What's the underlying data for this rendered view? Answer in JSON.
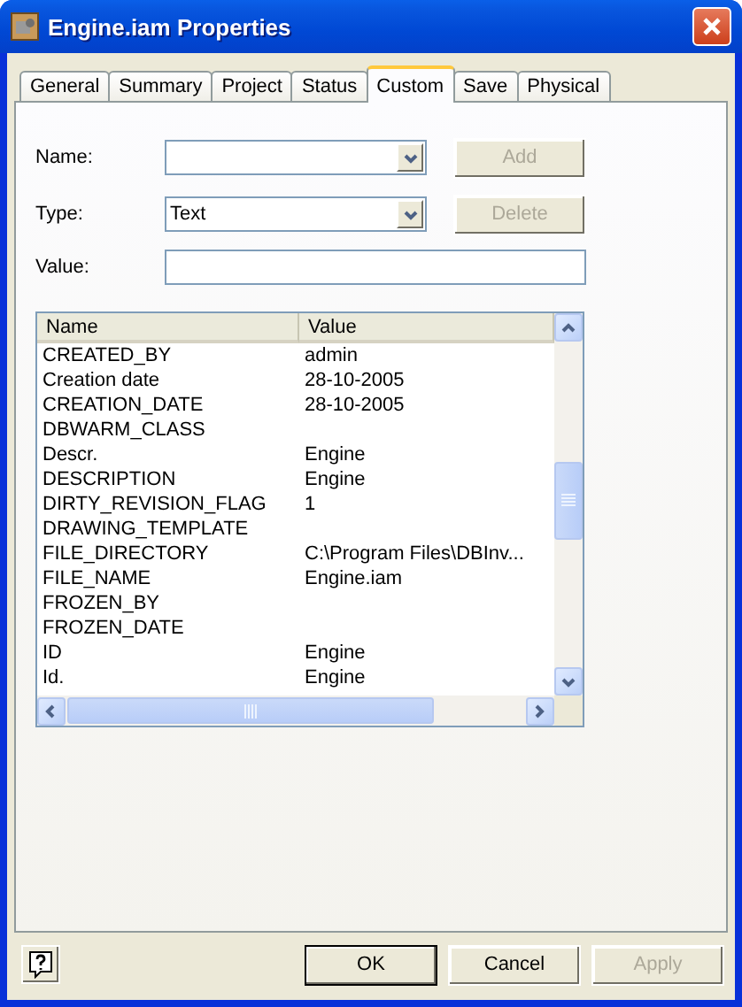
{
  "window": {
    "title": "Engine.iam Properties"
  },
  "tabs": [
    {
      "label": "General",
      "selected": false
    },
    {
      "label": "Summary",
      "selected": false
    },
    {
      "label": "Project",
      "selected": false
    },
    {
      "label": "Status",
      "selected": false
    },
    {
      "label": "Custom",
      "selected": true
    },
    {
      "label": "Save",
      "selected": false
    },
    {
      "label": "Physical",
      "selected": false
    }
  ],
  "form": {
    "name": {
      "label": "Name:",
      "action": {
        "label": "Add",
        "disabled": true
      }
    },
    "type": {
      "label": "Type:",
      "value": "Text",
      "action": {
        "label": "Delete",
        "disabled": true
      }
    },
    "value": {
      "label": "Value:"
    }
  },
  "table": {
    "columns": [
      "Name",
      "Value"
    ],
    "rows": [
      [
        "CREATED_BY",
        "admin"
      ],
      [
        "Creation date",
        "28-10-2005"
      ],
      [
        "CREATION_DATE",
        "28-10-2005"
      ],
      [
        "DBWARM_CLASS",
        ""
      ],
      [
        "Descr.",
        "Engine"
      ],
      [
        "DESCRIPTION",
        "Engine"
      ],
      [
        "DIRTY_REVISION_FLAG",
        "1"
      ],
      [
        "DRAWING_TEMPLATE",
        ""
      ],
      [
        "FILE_DIRECTORY",
        "C:\\Program Files\\DBInv..."
      ],
      [
        "FILE_NAME",
        "Engine.iam"
      ],
      [
        "FROZEN_BY",
        ""
      ],
      [
        "FROZEN_DATE",
        ""
      ],
      [
        "ID",
        "Engine"
      ],
      [
        "Id.",
        "Engine"
      ]
    ]
  },
  "buttons": [
    {
      "label": "OK",
      "disabled": false,
      "default": true
    },
    {
      "label": "Cancel",
      "disabled": false,
      "default": false
    },
    {
      "label": "Apply",
      "disabled": true,
      "default": false
    }
  ]
}
